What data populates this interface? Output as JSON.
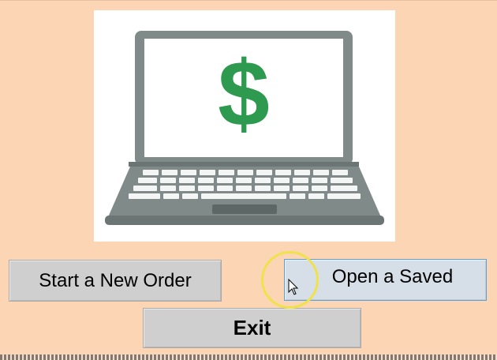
{
  "images": {
    "hero_icon": "laptop-dollar-icon",
    "dollar_symbol": "$"
  },
  "buttons": {
    "new_order": "Start a New Order",
    "open_saved": "Open a Saved",
    "exit": "Exit"
  },
  "colors": {
    "background": "#fbd5b4",
    "button_face": "#cfcfcf",
    "button_hover": "#d6dee8",
    "button_hover_border": "#5aa0d8",
    "dollar_green": "#2e9a4f",
    "laptop_gray": "#7f8a89",
    "click_highlight": "#f0e24a"
  }
}
